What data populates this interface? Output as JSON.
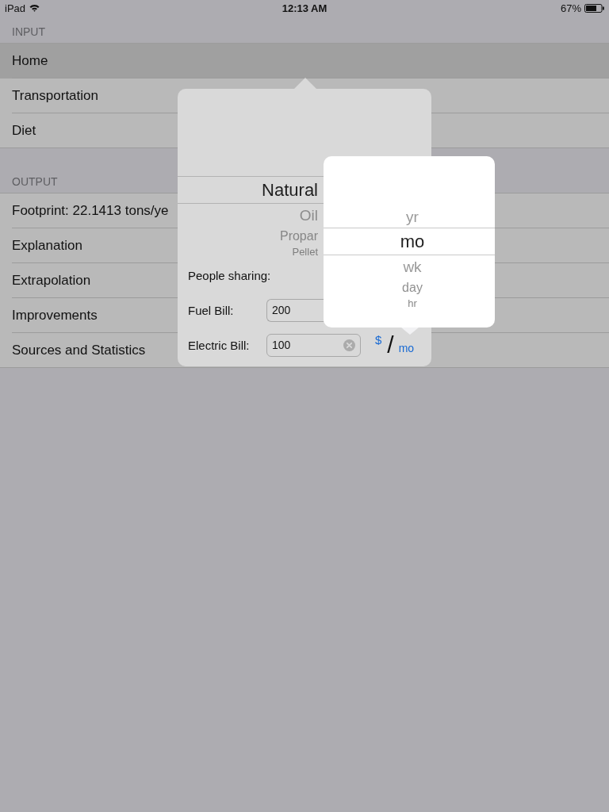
{
  "status_bar": {
    "carrier": "iPad",
    "time": "12:13 AM",
    "battery": "67%"
  },
  "sections": [
    {
      "header": "INPUT",
      "rows": [
        {
          "label": "Home",
          "selected": true
        },
        {
          "label": "Transportation",
          "selected": false
        },
        {
          "label": "Diet",
          "selected": false
        }
      ]
    },
    {
      "header": "OUTPUT",
      "rows": [
        {
          "label": "Footprint: 22.1413 tons/ye",
          "selected": false
        },
        {
          "label": "Explanation",
          "selected": false
        },
        {
          "label": "Extrapolation",
          "selected": false
        },
        {
          "label": "Improvements",
          "selected": false
        },
        {
          "label": "Sources and Statistics",
          "selected": false
        }
      ]
    }
  ],
  "fuel_popover": {
    "picker": [
      {
        "label": "Natural",
        "selected": true
      },
      {
        "label": "Oil",
        "selected": false
      },
      {
        "label": "Propar",
        "selected": false
      },
      {
        "label": "Pellet",
        "selected": false
      }
    ],
    "fields": [
      {
        "kind": "label",
        "label": "People sharing:"
      },
      {
        "kind": "input",
        "label": "Fuel Bill:",
        "value": "200",
        "editing": false
      },
      {
        "kind": "input",
        "label": "Electric Bill:",
        "value": "100",
        "editing": true,
        "unit": {
          "currency": "$",
          "separator": "/",
          "period": "mo"
        }
      }
    ]
  },
  "period_popover": {
    "picker": [
      {
        "label": "yr",
        "selected": false
      },
      {
        "label": "mo",
        "selected": true
      },
      {
        "label": "wk",
        "selected": false
      },
      {
        "label": "day",
        "selected": false
      },
      {
        "label": "hr",
        "selected": false
      }
    ]
  }
}
